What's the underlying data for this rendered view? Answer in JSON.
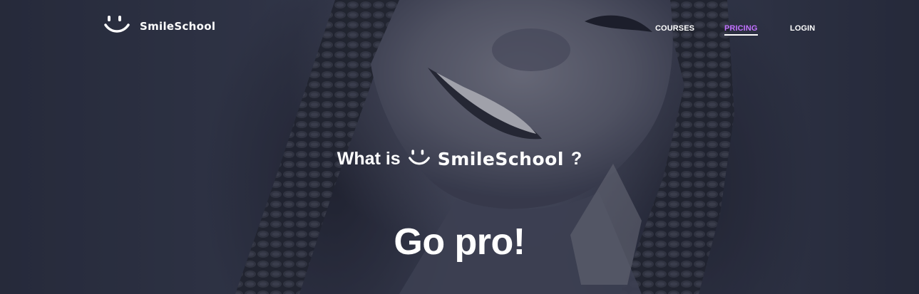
{
  "navbar": {
    "brand": {
      "logo_icon": "smile-icon",
      "name": "SmileSchool"
    },
    "links": [
      {
        "label": "COURSES",
        "active": false
      },
      {
        "label": "PRICING",
        "active": true
      },
      {
        "label": "LOGIN",
        "active": false
      }
    ]
  },
  "hero": {
    "question_prefix": "What is",
    "brand_icon": "smile-icon",
    "brand_name": "SmileSchool",
    "question_suffix": "?",
    "title": "Go pro!"
  },
  "colors": {
    "overlay": "#1f2433",
    "active_link": "#c271ff",
    "text": "#ffffff"
  }
}
